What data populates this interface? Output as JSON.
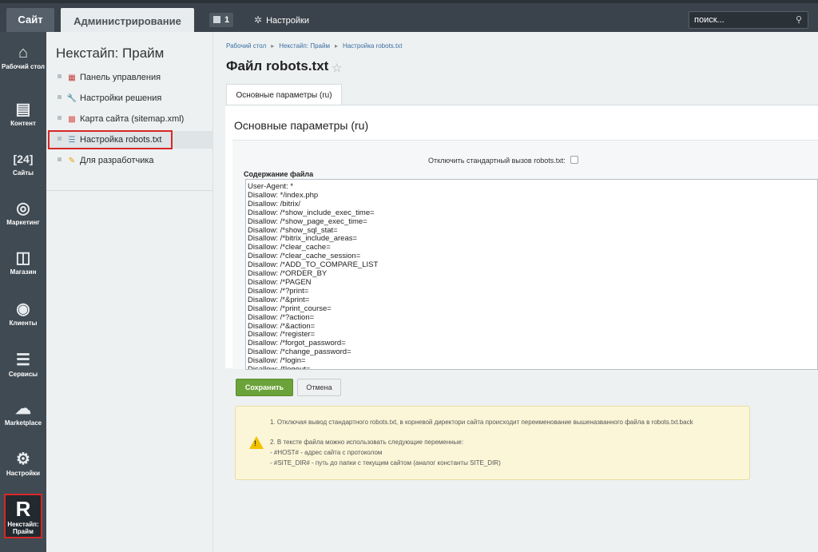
{
  "topbar": {
    "site_tab": "Сайт",
    "admin_tab": "Администрирование",
    "notifications_count": "1",
    "settings_label": "Настройки",
    "search_placeholder": "поиск..."
  },
  "left_menu": [
    {
      "label": "Рабочий стол",
      "icon": "home-icon"
    },
    {
      "label": "Контент",
      "icon": "document-icon"
    },
    {
      "label": "Сайты",
      "icon": "calendar-icon"
    },
    {
      "label": "Маркетинг",
      "icon": "target-icon"
    },
    {
      "label": "Магазин",
      "icon": "basket-icon"
    },
    {
      "label": "Клиенты",
      "icon": "clients-icon"
    },
    {
      "label": "Сервисы",
      "icon": "layers-icon"
    },
    {
      "label": "Marketplace",
      "icon": "cloud-upload-icon"
    },
    {
      "label": "Настройки",
      "icon": "gear-icon"
    },
    {
      "label": "Некстайп: Прайм",
      "icon": "nextype-logo-icon",
      "glyph": "R"
    }
  ],
  "secondary_menu": {
    "title": "Некстайп: Прайм",
    "items": [
      {
        "label": "Панель управления",
        "icon": "dashboard-icon"
      },
      {
        "label": "Настройки решения",
        "icon": "wrench-icon"
      },
      {
        "label": "Карта сайта (sitemap.xml)",
        "icon": "sitemap-icon"
      },
      {
        "label": "Настройка robots.txt",
        "icon": "list-icon"
      },
      {
        "label": "Для разработчика",
        "icon": "developer-icon"
      }
    ]
  },
  "breadcrumb": [
    "Рабочий стол",
    "Некстайп: Прайм",
    "Настройка robots.txt"
  ],
  "page_title": "Файл robots.txt",
  "tab": "Основные параметры (ru)",
  "section_title": "Основные параметры (ru)",
  "form": {
    "disable_default_label": "Отключить стандартный вызов robots.txt:",
    "disable_default_checked": false,
    "file_content_label": "Содержание файла",
    "file_content": "User-Agent: *\nDisallow: */index.php\nDisallow: /bitrix/\nDisallow: /*show_include_exec_time=\nDisallow: /*show_page_exec_time=\nDisallow: /*show_sql_stat=\nDisallow: /*bitrix_include_areas=\nDisallow: /*clear_cache=\nDisallow: /*clear_cache_session=\nDisallow: /*ADD_TO_COMPARE_LIST\nDisallow: /*ORDER_BY\nDisallow: /*PAGEN\nDisallow: /*?print=\nDisallow: /*&print=\nDisallow: /*print_course=\nDisallow: /*?action=\nDisallow: /*&action=\nDisallow: /*register=\nDisallow: /*forgot_password=\nDisallow: /*change_password=\nDisallow: /*login=\nDisallow: /*logout="
  },
  "buttons": {
    "save": "Сохранить",
    "cancel": "Отмена"
  },
  "notice": {
    "line1": "1. Отключая вывод стандартного robots.txt, в корневой директори сайта происходит переименование вышеназванного файла в robots.txt.back",
    "line2": "2. В тексте файла можно использовать следующие переменные:",
    "line3": "- #HOST# - адрес сайта с протоколом",
    "line4": "- #SITE_DIR# - путь до папки с текущим сайтом (аналог константы SITE_DIR)"
  }
}
